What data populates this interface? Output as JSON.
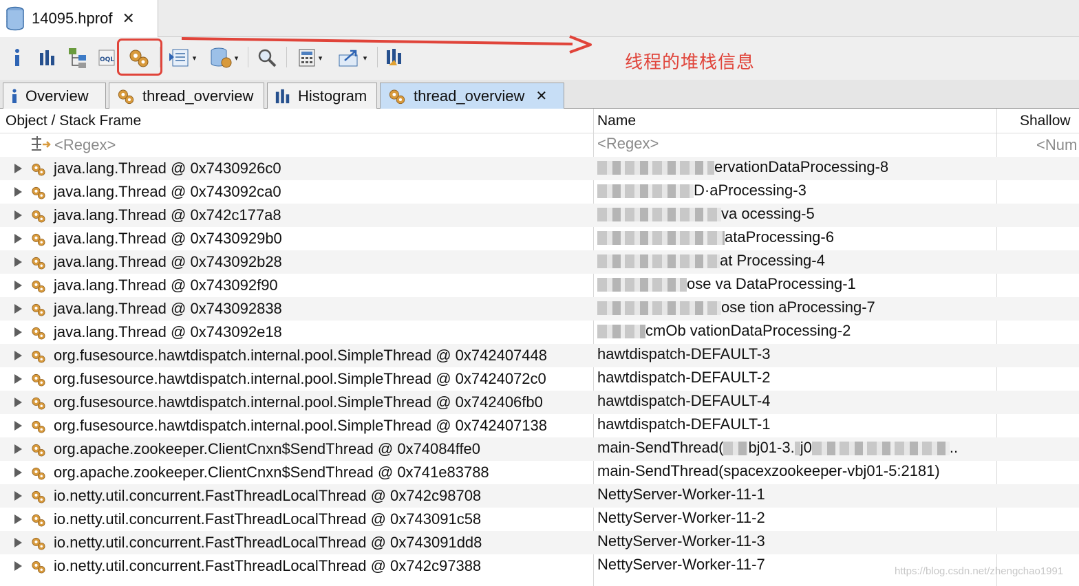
{
  "editor_tab": {
    "label": "14095.hprof",
    "close": "✕"
  },
  "toolbar": {
    "items": [
      "info-icon",
      "histogram-icon",
      "dominator-tree-icon",
      "oql-icon",
      "thread-overview-icon",
      "query-browser-icon",
      "heap-dump-overview-icon",
      "search-icon",
      "calculator-icon",
      "export-icon",
      "leak-suspects-icon"
    ],
    "caret": "▾",
    "annotation": "线程的堆栈信息",
    "annotation_color": "#e0443a"
  },
  "view_tabs": [
    {
      "label": "Overview",
      "icon": "info-icon",
      "active": false
    },
    {
      "label": "thread_overview",
      "icon": "gear-icon",
      "active": false
    },
    {
      "label": "Histogram",
      "icon": "histogram-icon",
      "active": false
    },
    {
      "label": "thread_overview",
      "icon": "gear-icon",
      "active": true,
      "close": "✕"
    }
  ],
  "table": {
    "columns": [
      "Object / Stack Frame",
      "Name",
      "Shallow"
    ],
    "regex_row": {
      "object": "<Regex>",
      "name": "<Regex>",
      "shallow": "<Num"
    },
    "rows": [
      {
        "object": "java.lang.Thread @ 0x7430926c0",
        "name": "ervationDataProcessing-8"
      },
      {
        "object": "java.lang.Thread @ 0x743092ca0",
        "name": "D·aProcessing-3"
      },
      {
        "object": "java.lang.Thread @ 0x742c177a8",
        "name": "va ocessing-5"
      },
      {
        "object": "java.lang.Thread @ 0x7430929b0",
        "name": "ataProcessing-6"
      },
      {
        "object": "java.lang.Thread @ 0x743092b28",
        "name": "at Processing-4"
      },
      {
        "object": "java.lang.Thread @ 0x743092f90",
        "name": "ose va DataProcessing-1"
      },
      {
        "object": "java.lang.Thread @ 0x743092838",
        "name": "ose tion aProcessing-7"
      },
      {
        "object": "java.lang.Thread @ 0x743092e18",
        "name": "cmOb vationDataProcessing-2"
      },
      {
        "object": "org.fusesource.hawtdispatch.internal.pool.SimpleThread @ 0x742407448",
        "name": "hawtdispatch-DEFAULT-3"
      },
      {
        "object": "org.fusesource.hawtdispatch.internal.pool.SimpleThread @ 0x7424072c0",
        "name": "hawtdispatch-DEFAULT-2"
      },
      {
        "object": "org.fusesource.hawtdispatch.internal.pool.SimpleThread @ 0x742406fb0",
        "name": "hawtdispatch-DEFAULT-4"
      },
      {
        "object": "org.fusesource.hawtdispatch.internal.pool.SimpleThread @ 0x742407138",
        "name": "hawtdispatch-DEFAULT-1"
      },
      {
        "object": "org.apache.zookeeper.ClientCnxn$SendThread @ 0x74084ffe0",
        "name": "main-SendThread(",
        "name_tail": "bj01-3.",
        "name_tail2": "j0",
        "name_end": ".."
      },
      {
        "object": "org.apache.zookeeper.ClientCnxn$SendThread @ 0x741e83788",
        "name": "main-SendThread(spacexzookeeper-vbj01-5:2181)"
      },
      {
        "object": "io.netty.util.concurrent.FastThreadLocalThread @ 0x742c98708",
        "name": "NettyServer-Worker-11-1"
      },
      {
        "object": "io.netty.util.concurrent.FastThreadLocalThread @ 0x743091c58",
        "name": "NettyServer-Worker-11-2"
      },
      {
        "object": "io.netty.util.concurrent.FastThreadLocalThread @ 0x743091dd8",
        "name": "NettyServer-Worker-11-3"
      },
      {
        "object": "io.netty.util.concurrent.FastThreadLocalThread @ 0x742c97388",
        "name": "NettyServer-Worker-11-7"
      }
    ]
  },
  "watermark": "https://blog.csdn.net/zhengchao1991"
}
